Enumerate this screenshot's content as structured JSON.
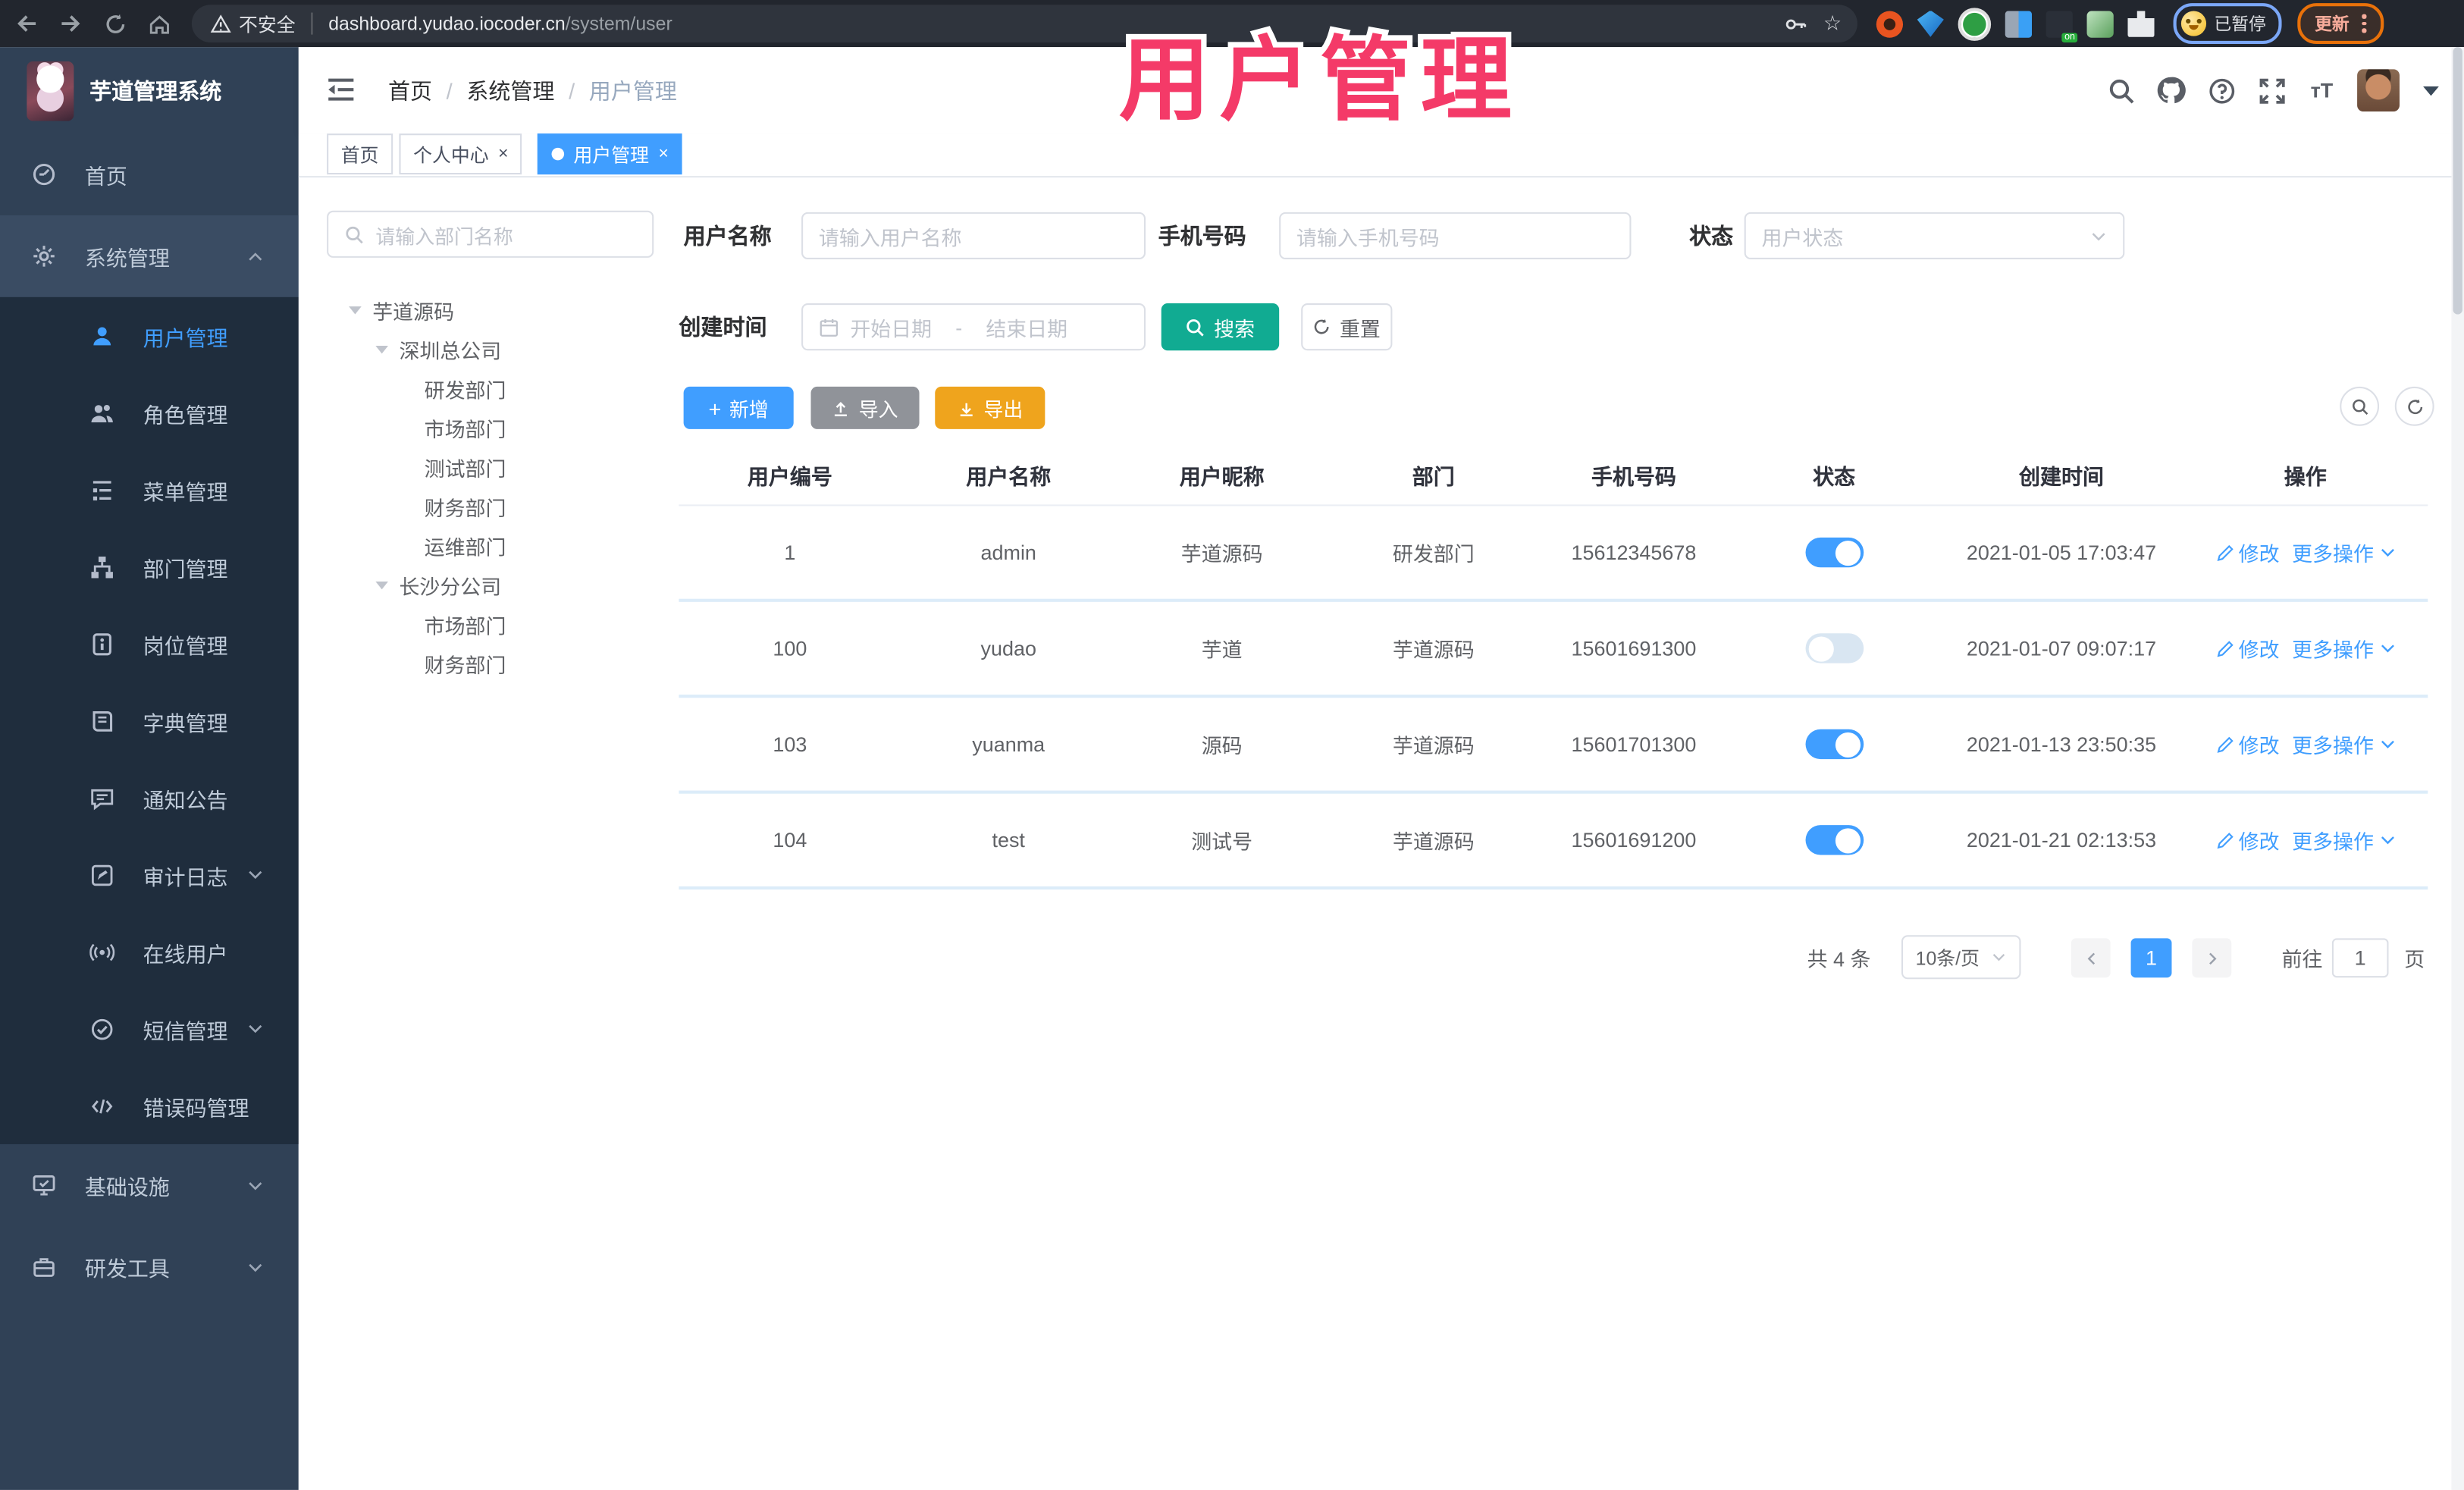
{
  "browser": {
    "security_label": "不安全",
    "url_host": "dashboard.yudao.iocoder.cn",
    "url_path": "/system/user",
    "profile_status": "已暂停",
    "update_label": "更新"
  },
  "overlay": {
    "text": "用户管理",
    "color": "#f43a68"
  },
  "app": {
    "title": "芋道管理系统"
  },
  "breadcrumb": {
    "separator": "/",
    "items": [
      "首页",
      "系统管理",
      "用户管理"
    ]
  },
  "tabs": [
    {
      "label": "首页",
      "closable": false,
      "active": false
    },
    {
      "label": "个人中心",
      "closable": true,
      "active": false,
      "close": "×"
    },
    {
      "label": "用户管理",
      "closable": true,
      "active": true,
      "close": "×"
    }
  ],
  "sidebar": {
    "items": [
      {
        "label": "首页",
        "icon": "dashboard-icon"
      },
      {
        "label": "系统管理",
        "icon": "gear-icon",
        "state": "expanded"
      },
      {
        "label": "用户管理",
        "icon": "user-icon",
        "state": "active"
      },
      {
        "label": "角色管理",
        "icon": "peoples-icon"
      },
      {
        "label": "菜单管理",
        "icon": "menu-tree-icon"
      },
      {
        "label": "部门管理",
        "icon": "org-tree-icon"
      },
      {
        "label": "岗位管理",
        "icon": "post-icon"
      },
      {
        "label": "字典管理",
        "icon": "dict-icon"
      },
      {
        "label": "通知公告",
        "icon": "message-icon"
      },
      {
        "label": "审计日志",
        "icon": "log-icon",
        "state": "collapsed"
      },
      {
        "label": "在线用户",
        "icon": "online-icon"
      },
      {
        "label": "短信管理",
        "icon": "sms-icon",
        "state": "collapsed"
      },
      {
        "label": "错误码管理",
        "icon": "code-icon"
      },
      {
        "label": "基础设施",
        "icon": "infra-icon",
        "state": "collapsed"
      },
      {
        "label": "研发工具",
        "icon": "tools-icon",
        "state": "collapsed"
      }
    ]
  },
  "tree": {
    "search_placeholder": "请输入部门名称",
    "nodes": [
      {
        "label": "芋道源码",
        "level": 1,
        "expandable": true
      },
      {
        "label": "深圳总公司",
        "level": 2,
        "expandable": true
      },
      {
        "label": "研发部门",
        "level": 3
      },
      {
        "label": "市场部门",
        "level": 3
      },
      {
        "label": "测试部门",
        "level": 3
      },
      {
        "label": "财务部门",
        "level": 3
      },
      {
        "label": "运维部门",
        "level": 3
      },
      {
        "label": "长沙分公司",
        "level": 2,
        "expandable": true
      },
      {
        "label": "市场部门",
        "level": 3
      },
      {
        "label": "财务部门",
        "level": 3
      }
    ]
  },
  "filters": {
    "username_label": "用户名称",
    "username_placeholder": "请输入用户名称",
    "mobile_label": "手机号码",
    "mobile_placeholder": "请输入手机号码",
    "status_label": "状态",
    "status_placeholder": "用户状态",
    "createtime_label": "创建时间",
    "date_start_placeholder": "开始日期",
    "date_separator": "-",
    "date_end_placeholder": "结束日期",
    "search_label": "搜索",
    "reset_label": "重置"
  },
  "toolbar": {
    "add_label": "新增",
    "import_label": "导入",
    "export_label": "导出"
  },
  "table": {
    "columns": [
      "用户编号",
      "用户名称",
      "用户昵称",
      "部门",
      "手机号码",
      "状态",
      "创建时间",
      "操作"
    ],
    "edit_label": "修改",
    "more_label": "更多操作",
    "rows": [
      {
        "id": "1",
        "username": "admin",
        "nickname": "芋道源码",
        "dept": "研发部门",
        "mobile": "15612345678",
        "status": true,
        "created": "2021-01-05 17:03:47"
      },
      {
        "id": "100",
        "username": "yudao",
        "nickname": "芋道",
        "dept": "芋道源码",
        "mobile": "15601691300",
        "status": false,
        "created": "2021-01-07 09:07:17"
      },
      {
        "id": "103",
        "username": "yuanma",
        "nickname": "源码",
        "dept": "芋道源码",
        "mobile": "15601701300",
        "status": true,
        "created": "2021-01-13 23:50:35"
      },
      {
        "id": "104",
        "username": "test",
        "nickname": "测试号",
        "dept": "芋道源码",
        "mobile": "15601691200",
        "status": true,
        "created": "2021-01-21 02:13:53"
      }
    ]
  },
  "pagination": {
    "total_label": "共 4 条",
    "page_size_label": "10条/页",
    "current_page": "1",
    "goto_label": "前往",
    "goto_value": "1",
    "unit_label": "页"
  },
  "colors": {
    "primary": "#409eff",
    "success_teal": "#11ab92",
    "warning_amber": "#efa41d",
    "info_gray": "#909399",
    "sidebar_bg": "#304156",
    "submenu_bg": "#1f2d3d",
    "overlay_pink": "#f43a68"
  }
}
